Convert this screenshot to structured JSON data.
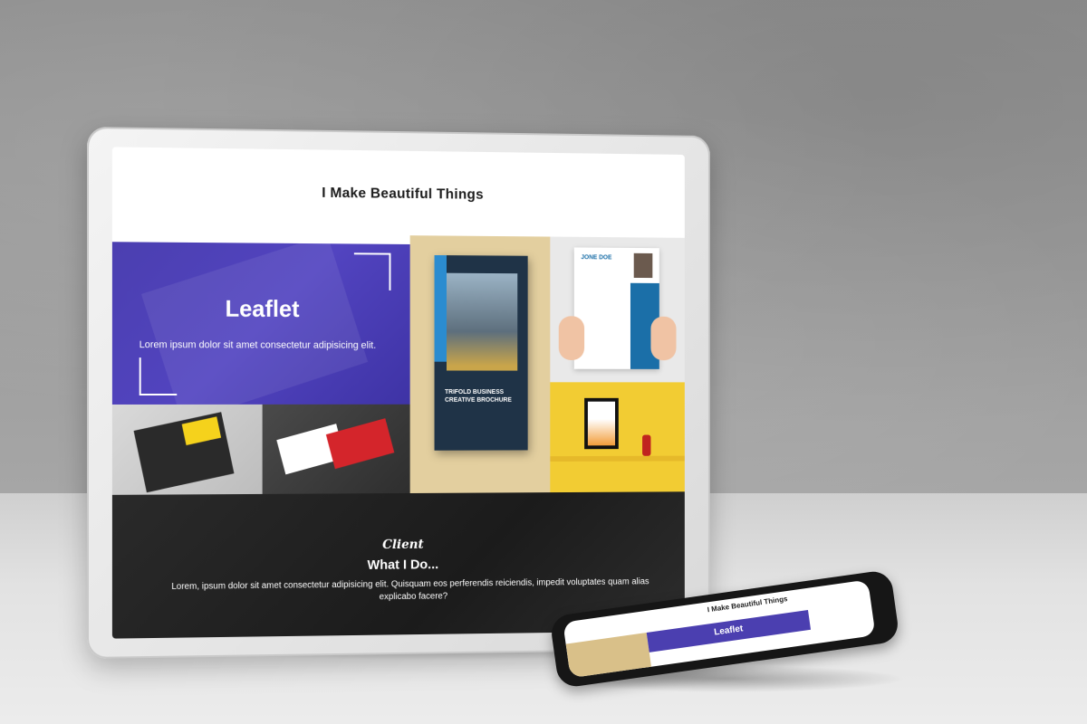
{
  "site": {
    "title": "I Make Beautiful Things"
  },
  "hero": {
    "heading": "Leaflet",
    "text": "Lorem ipsum dolor sit amet consectetur adipisicing elit."
  },
  "gallery": {
    "brochure_caption": "TRIFOLD BUSINESS CREATIVE BROCHURE",
    "resume_name": "JONE DOE"
  },
  "section": {
    "script_label": "Client",
    "heading": "What I Do...",
    "text": "Lorem, ipsum dolor sit amet consectetur adipisicing elit. Quisquam eos perferendis reiciendis, impedit voluptates quam alias explicabo facere?"
  },
  "phone": {
    "title": "I Make Beautiful Things",
    "leaflet": "Leaflet"
  },
  "colors": {
    "leaflet_bg": "#4b3fb0",
    "brochure_bg": "#e3cf9f",
    "frame_bg": "#f2cc33",
    "dark_bg": "#1b1b1b"
  }
}
